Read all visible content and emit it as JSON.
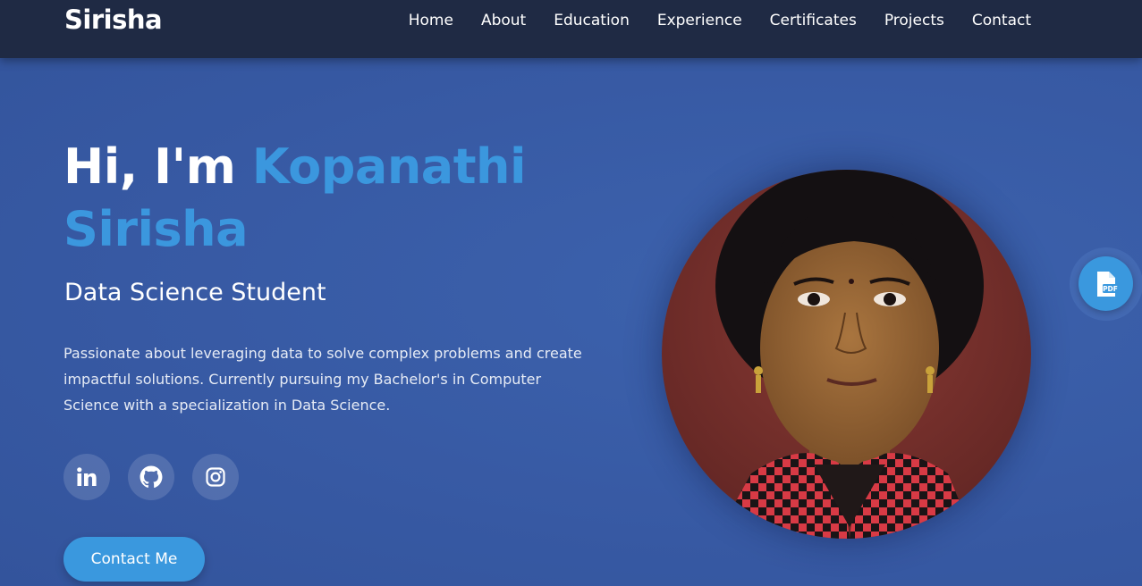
{
  "navbar": {
    "brand": "Sirisha",
    "links": [
      "Home",
      "About",
      "Education",
      "Experience",
      "Certificates",
      "Projects",
      "Contact"
    ]
  },
  "hero": {
    "greeting": "Hi, I'm",
    "name": "Kopanathi Sirisha",
    "subtitle": "Data Science Student",
    "description": "Passionate about leveraging data to solve complex problems and create impactful solutions. Currently pursuing my Bachelor's in Computer Science with a specialization in Data Science.",
    "socials": [
      {
        "icon": "linkedin-icon"
      },
      {
        "icon": "github-icon"
      },
      {
        "icon": "instagram-icon"
      }
    ],
    "contact_button": "Contact Me"
  },
  "profile_photo": {
    "icon": "profile-photo"
  },
  "resume_button": {
    "icon": "pdf-icon",
    "label": "PDF"
  },
  "colors": {
    "navbar_bg": "#1f2a44",
    "hero_bg": "#3759a3",
    "accent": "#3b97de",
    "text": "#ffffff"
  }
}
